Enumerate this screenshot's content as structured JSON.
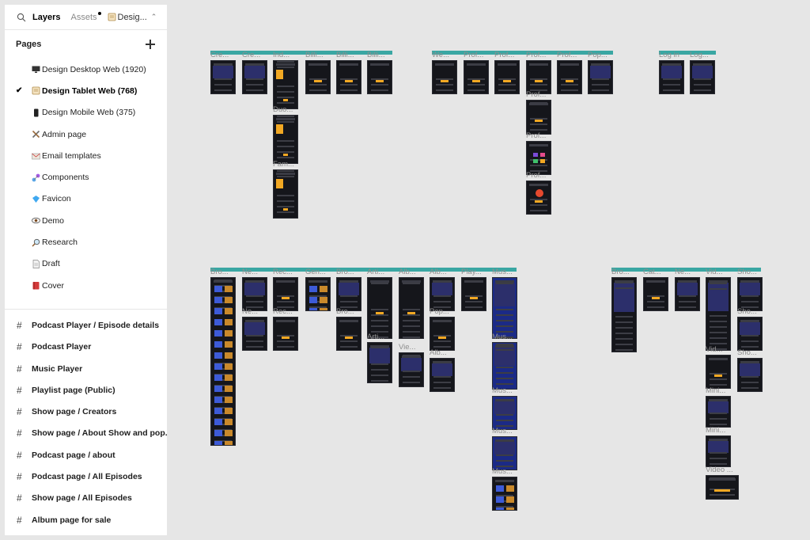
{
  "toolbar": {
    "layers_tab": "Layers",
    "assets_tab": "Assets",
    "file_name": "Desig..."
  },
  "pages": {
    "title": "Pages",
    "items": [
      {
        "label": "Design Desktop Web (1920)",
        "icon": "desktop-icon"
      },
      {
        "label": "Design Tablet Web (768)",
        "icon": "tablet-icon",
        "current": true
      },
      {
        "label": "Design Mobile Web (375)",
        "icon": "mobile-icon"
      },
      {
        "label": "Admin page",
        "icon": "tools-icon"
      },
      {
        "label": "Email templates",
        "icon": "email-icon"
      },
      {
        "label": "Components",
        "icon": "components-icon"
      },
      {
        "label": "Favicon",
        "icon": "diamond-icon"
      },
      {
        "label": "Demo",
        "icon": "eye-icon"
      },
      {
        "label": "Research",
        "icon": "magnifier-icon"
      },
      {
        "label": "Draft",
        "icon": "document-icon"
      },
      {
        "label": "Cover",
        "icon": "book-icon"
      }
    ]
  },
  "layers": [
    "Podcast Player / Episode details",
    "Podcast Player",
    "Music Player",
    "Playlist page (Public)",
    "Show page / Creators",
    "Show page / About Show and pop...",
    "Podcast page / about",
    "Podcast page / All Episodes",
    "Show page / All Episodes",
    "Album page for sale"
  ],
  "canvas": {
    "frame_labels": [
      "Cre...",
      "Cre...",
      "Ind...",
      "Billi...",
      "Billi...",
      "Billi...",
      "Duo...",
      "Fam...",
      "We...",
      "Prof...",
      "Prof...",
      "Prof...",
      "Prof...",
      "Pop...",
      "Prof...",
      "Prof...",
      "Prof...",
      "Log in",
      "Log...",
      "Bro...",
      "Ne...",
      "Rec...",
      "Gen...",
      "Bro...",
      "Arti...",
      "Alb...",
      "Alb...",
      "Play...",
      "Mus...",
      "Ne...",
      "Rec...",
      "Bro...",
      "Arti...",
      "Vie...",
      "Pop...",
      "Alb...",
      "Mus...",
      "Mus...",
      "Mus...",
      "Mus...",
      "Bro...",
      "Cat...",
      "Ne...",
      "Vid...",
      "Sho...",
      "Vid...",
      "Sho...",
      "Sho...",
      "Mini...",
      "Mini...",
      "Video ..."
    ]
  },
  "colors": {
    "canvas_bg": "#e6e6e6",
    "section_bar": "#3aa7a3",
    "frame_dark": "#15161b",
    "accent": "#f2a823"
  }
}
